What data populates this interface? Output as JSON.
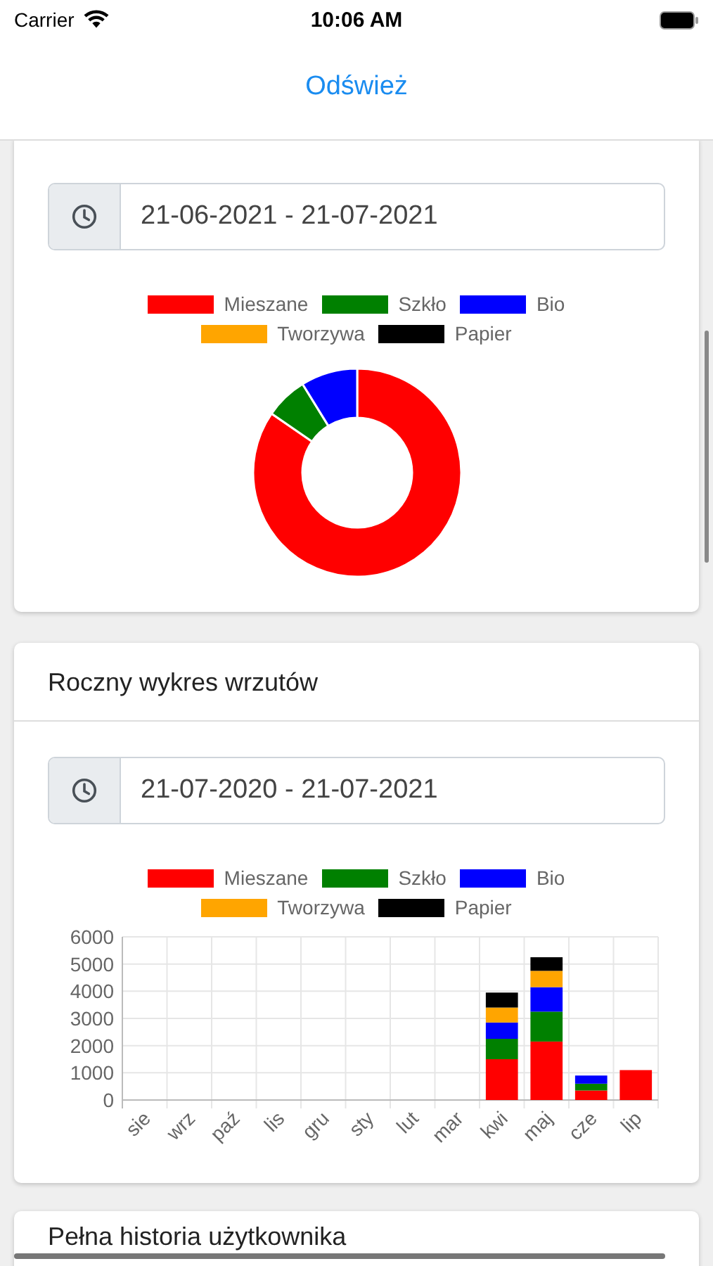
{
  "status_bar": {
    "carrier": "Carrier",
    "time": "10:06 AM"
  },
  "nav": {
    "refresh_button": "Odśwież"
  },
  "cards": [
    {
      "kind": "donut",
      "date_range": "21-06-2021 - 21-07-2021",
      "legend": [
        {
          "name": "Mieszane",
          "color": "#ff0000"
        },
        {
          "name": "Szkło",
          "color": "#008000"
        },
        {
          "name": "Bio",
          "color": "#0000ff"
        },
        {
          "name": "Tworzywa",
          "color": "#ffa500"
        },
        {
          "name": "Papier",
          "color": "#000000"
        }
      ]
    },
    {
      "kind": "bar",
      "title": "Roczny wykres wrzutów",
      "date_range": "21-07-2020 - 21-07-2021",
      "chart_data": {
        "type": "bar",
        "stacked": true,
        "grid": true,
        "categories": [
          "sie",
          "wrz",
          "paź",
          "lis",
          "gru",
          "sty",
          "lut",
          "mar",
          "kwi",
          "maj",
          "cze",
          "lip"
        ],
        "ylim": [
          0,
          6000
        ],
        "yticks": [
          0,
          1000,
          2000,
          3000,
          4000,
          5000,
          6000
        ],
        "series": [
          {
            "name": "Mieszane",
            "color": "#ff0000",
            "values": [
              0,
              0,
              0,
              0,
              0,
              0,
              0,
              0,
              1500,
              2150,
              350,
              1100
            ]
          },
          {
            "name": "Szkło",
            "color": "#008000",
            "values": [
              0,
              0,
              0,
              0,
              0,
              0,
              0,
              0,
              750,
              1100,
              250,
              0
            ]
          },
          {
            "name": "Bio",
            "color": "#0000ff",
            "values": [
              0,
              0,
              0,
              0,
              0,
              0,
              0,
              0,
              600,
              900,
              300,
              0
            ]
          },
          {
            "name": "Tworzywa",
            "color": "#ffa500",
            "values": [
              0,
              0,
              0,
              0,
              0,
              0,
              0,
              0,
              550,
              600,
              0,
              0
            ]
          },
          {
            "name": "Papier",
            "color": "#000000",
            "values": [
              0,
              0,
              0,
              0,
              0,
              0,
              0,
              0,
              550,
              500,
              0,
              0
            ]
          }
        ]
      }
    },
    {
      "kind": "header",
      "title": "Pełna historia użytkownika"
    }
  ]
}
